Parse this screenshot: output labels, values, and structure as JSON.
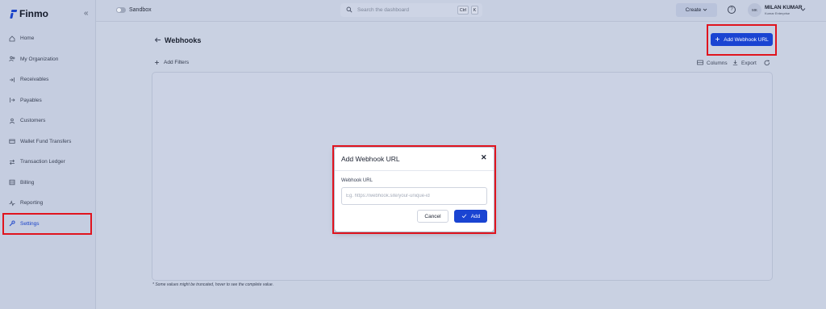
{
  "brand": {
    "name": "Finmo",
    "accent": "#1a44d2",
    "highlight": "#e0141e"
  },
  "sidebar": {
    "collapse_icon": "double-chevron-left-icon",
    "items": [
      {
        "label": "Home",
        "icon": "home-icon"
      },
      {
        "label": "My Organization",
        "icon": "people-icon"
      },
      {
        "label": "Receivables",
        "icon": "arrow-in-icon"
      },
      {
        "label": "Payables",
        "icon": "arrow-out-icon"
      },
      {
        "label": "Customers",
        "icon": "person-icon"
      },
      {
        "label": "Wallet Fund Transfers",
        "icon": "wallet-icon"
      },
      {
        "label": "Transaction Ledger",
        "icon": "swap-icon"
      },
      {
        "label": "Billing",
        "icon": "stack-icon"
      },
      {
        "label": "Reporting",
        "icon": "pulse-icon"
      },
      {
        "label": "Settings",
        "icon": "wrench-icon",
        "active": true
      }
    ]
  },
  "topbar": {
    "sandbox_label": "Sandbox",
    "search_placeholder": "Search the dashboard",
    "shortcut_ctrl": "Ctrl",
    "shortcut_key": "K",
    "create_label": "Create",
    "help_glyph": "?",
    "user": {
      "initials": "MK",
      "name": "MILAN KUMAR",
      "org": "Kumar Enterprise"
    }
  },
  "page": {
    "title": "Webhooks",
    "add_button_label": "Add Webhook URL",
    "add_filters_label": "Add Filters",
    "columns_label": "Columns",
    "export_label": "Export",
    "footnote": "* Some values might be truncated, hover to see the complete value."
  },
  "modal": {
    "title": "Add Webhook URL",
    "field_label": "Webhook URL",
    "field_placeholder": "Eg. https://webhook.site/your-unique-id",
    "field_value": "",
    "cancel_label": "Cancel",
    "add_label": "Add"
  }
}
